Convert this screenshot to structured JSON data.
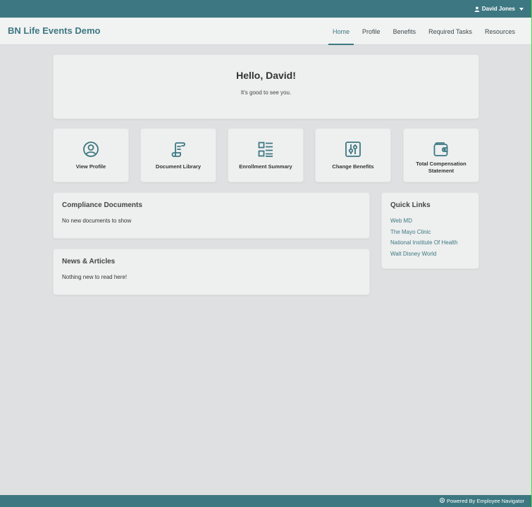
{
  "topbar": {
    "user_name": "David Jones",
    "user_icon": "user-icon",
    "menu_icon": "caret-down-icon"
  },
  "navbar": {
    "brand": "BN Life Events Demo",
    "items": [
      {
        "label": "Home",
        "active": true
      },
      {
        "label": "Profile"
      },
      {
        "label": "Benefits"
      },
      {
        "label": "Required Tasks"
      },
      {
        "label": "Resources"
      }
    ]
  },
  "greeting": {
    "title": "Hello, David!",
    "subtitle": "It's good to see you."
  },
  "tiles": [
    {
      "label": "View Profile",
      "icon": "user-circle-icon"
    },
    {
      "label": "Document Library",
      "icon": "scroll-icon"
    },
    {
      "label": "Enrollment Summary",
      "icon": "list-icon"
    },
    {
      "label": "Change Benefits",
      "icon": "sliders-icon"
    },
    {
      "label": "Total Compensation Statement",
      "icon": "wallet-icon"
    }
  ],
  "compliance": {
    "title": "Compliance Documents",
    "empty_text": "No new documents to show"
  },
  "news": {
    "title": "News & Articles",
    "empty_text": "Nothing new to read here!"
  },
  "quick_links": {
    "title": "Quick Links",
    "links": [
      "Web MD",
      "The Mayo Clinic",
      "National Institute Of Health",
      "Walt Disney World"
    ]
  },
  "footer": {
    "text": "Powered By Employee Navigator",
    "icon": "logo-dot-icon"
  },
  "colors": {
    "accent": "#3d7882",
    "background": "#dfe0e1",
    "card": "#eeefef"
  }
}
